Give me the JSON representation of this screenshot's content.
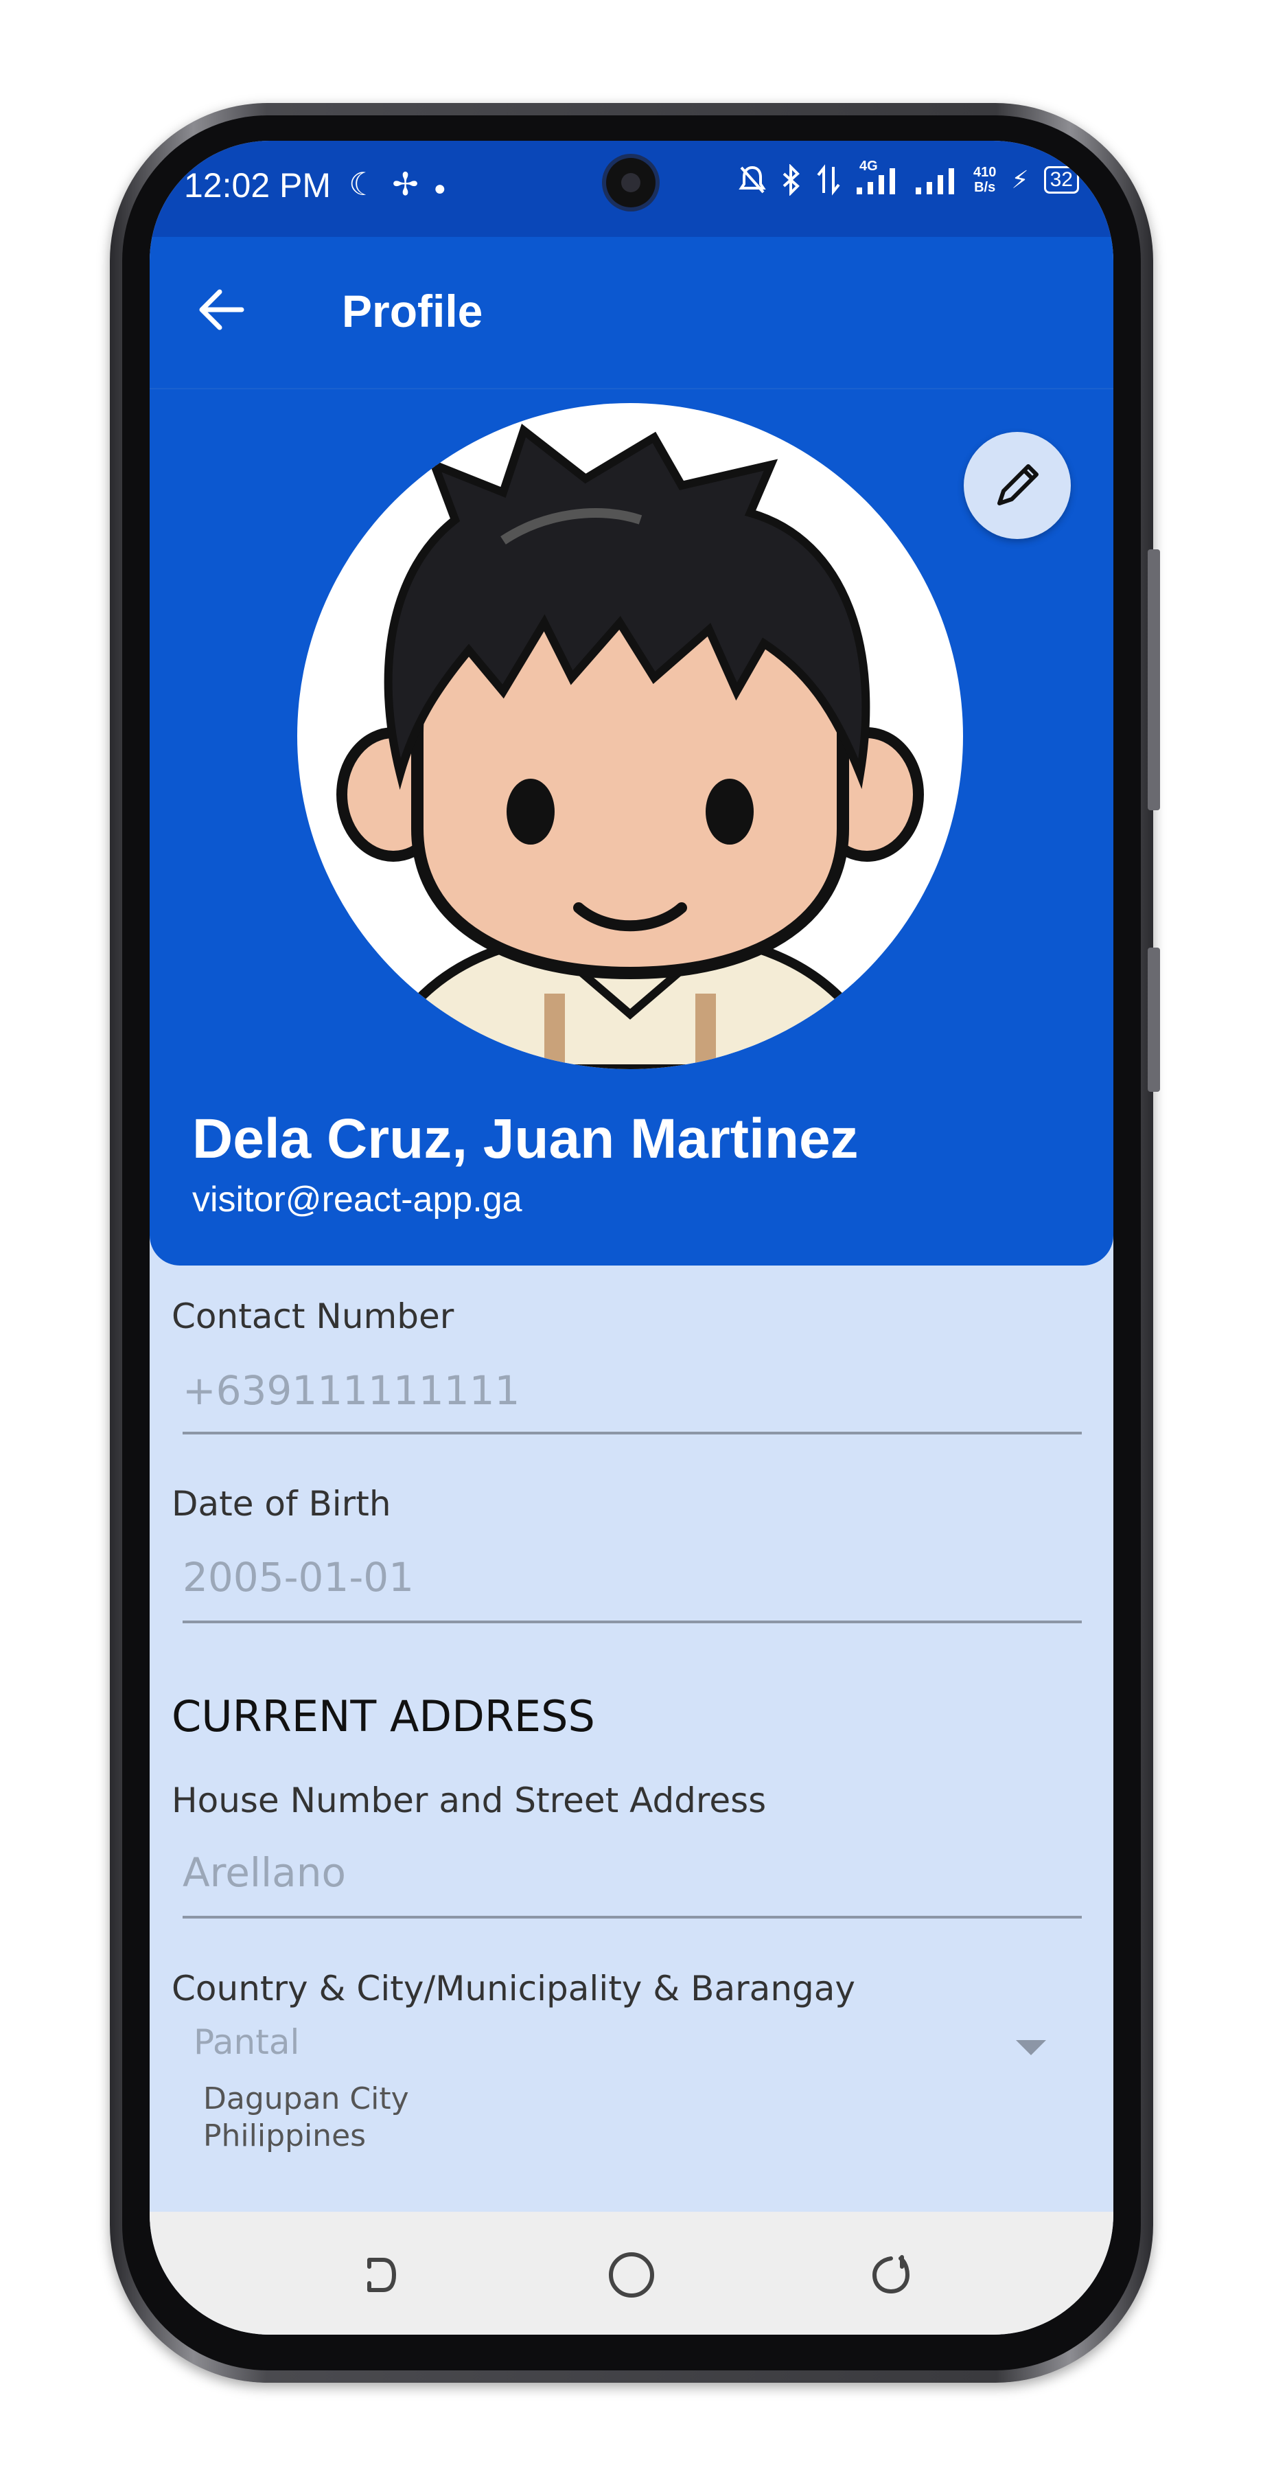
{
  "status_bar": {
    "time": "12:02 PM",
    "left_icons": [
      "moon-icon",
      "fan-icon",
      "dot-icon"
    ],
    "right_icons": [
      "mute-icon",
      "bluetooth-icon",
      "data-transfer-icon",
      "signal-4g-icon",
      "signal-icon"
    ],
    "network_type": "4G",
    "net_speed_value": "410",
    "net_speed_unit": "B/s",
    "battery": "32"
  },
  "app_bar": {
    "title": "Profile",
    "back_icon": "arrow-left-icon"
  },
  "profile": {
    "name": "Dela Cruz, Juan Martinez",
    "email": "visitor@react-app.ga",
    "edit_icon": "pencil-icon"
  },
  "form": {
    "contact": {
      "label": "Contact Number",
      "value": "+639111111111"
    },
    "dob": {
      "label": "Date of Birth",
      "value": "2005-01-01"
    },
    "section_title": "CURRENT ADDRESS",
    "street": {
      "label": "House Number and Street Address",
      "value": "Arellano"
    },
    "location": {
      "label": "Country & City/Municipality & Barangay",
      "value": "Pantal",
      "city": "Dagupan City",
      "country": "Philippines"
    }
  },
  "colors": {
    "primary": "#0c58d0",
    "status_bar": "#0a47b8",
    "form_background": "#d3e2f9",
    "nav_background": "#eeeeee"
  }
}
